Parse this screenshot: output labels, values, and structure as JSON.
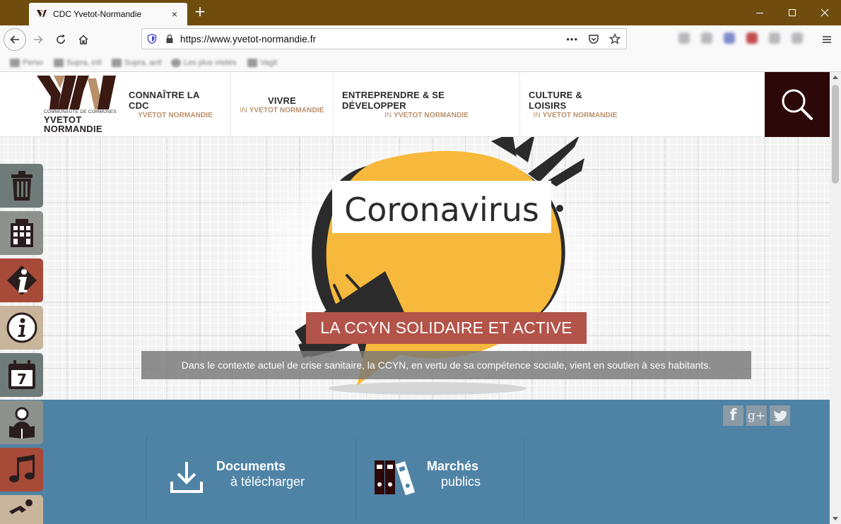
{
  "browser": {
    "tab_title": "CDC Yvetot-Normandie",
    "tab_close": "×",
    "new_tab": "+",
    "url": "https://www.yvetot-normandie.fr",
    "page_actions": "•••",
    "bookmarks": [
      "Perso",
      "Supra, intl",
      "Supra, actl",
      "Les plus visités",
      "Vagit"
    ]
  },
  "site": {
    "logo": {
      "letters": "YN",
      "subtitle": "COMMUNAUTÉ DE COMMUNES",
      "name_line1": "YVETOT",
      "name_line2": "NORMANDIE"
    },
    "menu": [
      {
        "title": "CONNAÎTRE LA CDC",
        "prefix": "",
        "sub": "YVETOT NORMANDIE"
      },
      {
        "title": "VIVRE",
        "prefix": "IN ",
        "sub": "YVETOT NORMANDIE"
      },
      {
        "title": "ENTREPRENDRE & SE DÉVELOPPER",
        "prefix": "IN ",
        "sub": "YVETOT NORMANDIE"
      },
      {
        "title": "CULTURE & LOISIRS",
        "prefix": "IN ",
        "sub": "YVETOT NORMANDIE"
      }
    ],
    "hero": {
      "bubble_text": "Coronavirus",
      "title": "LA CCYN SOLIDAIRE ET ACTIVE",
      "caption": "Dans le contexte actuel de crise sanitaire, la CCYN, en vertu de sa compétence sociale, vient en soutien à ses habitants."
    },
    "social": {
      "facebook": "f",
      "googleplus": "g+",
      "twitter": "twitter"
    },
    "quick_links": [
      {
        "title": "Documents",
        "sub": "à télécharger"
      },
      {
        "title": "Marchés",
        "sub": "publics"
      }
    ],
    "sidebar": {
      "calendar_day": "7"
    }
  },
  "colors": {
    "titlebar": "#6e4d0f",
    "menu_accent": "#b8906a",
    "search_bg": "#2d0808",
    "hero_title_bg": "#b3544a",
    "band_blue": "#4f83a6",
    "bubble_yellow": "#f6b93b"
  }
}
